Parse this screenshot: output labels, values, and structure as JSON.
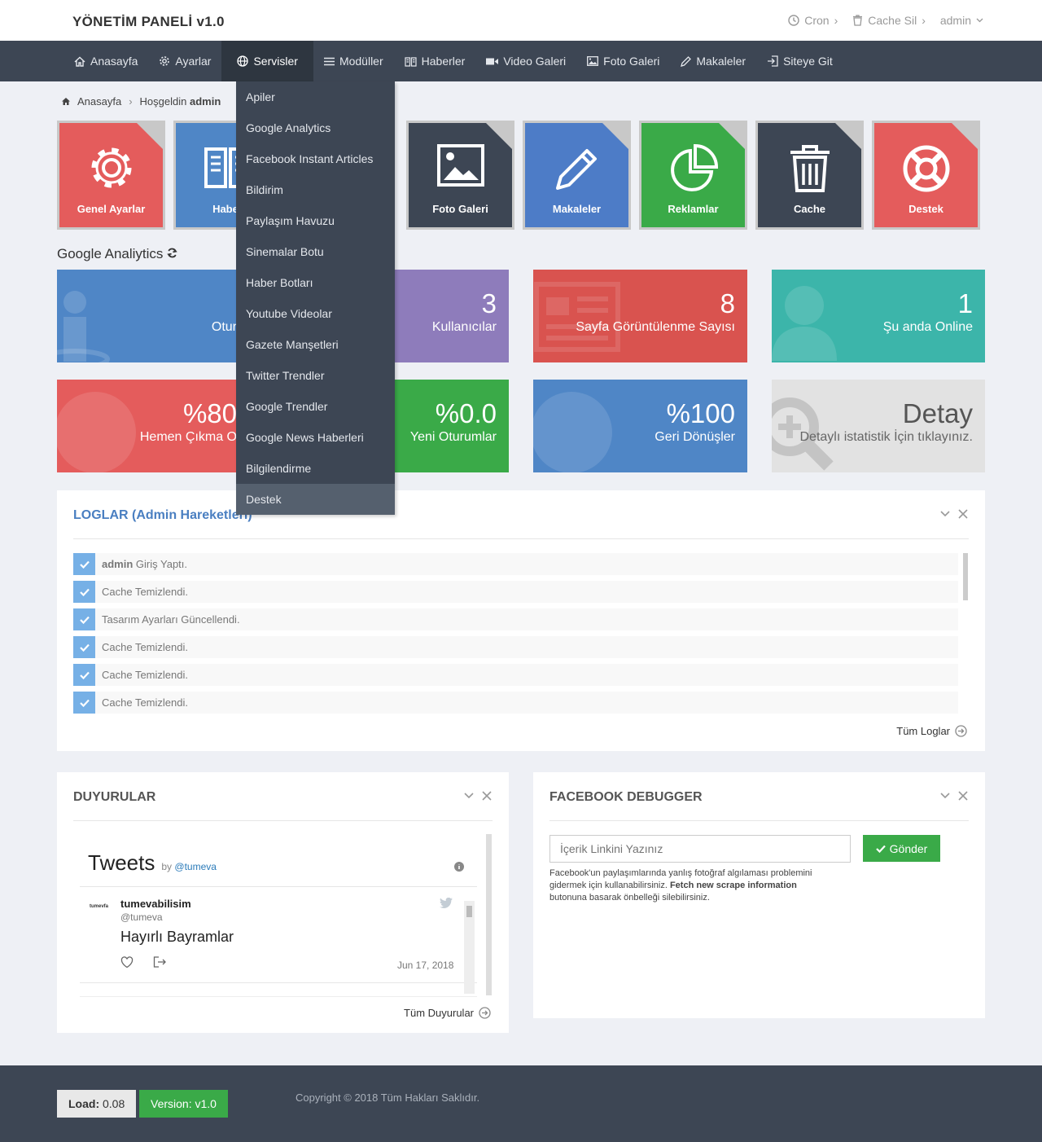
{
  "brand": {
    "name": "YÖNETİM PANELİ",
    "version": "v1.0"
  },
  "top": {
    "cron": "Cron",
    "cache": "Cache Sil",
    "user": "admin"
  },
  "nav": [
    "Anasayfa",
    "Ayarlar",
    "Servisler",
    "Modüller",
    "Haberler",
    "Video Galeri",
    "Foto Galeri",
    "Makaleler",
    "Siteye Git"
  ],
  "dropdown": [
    "Apiler",
    "Google Analytics",
    "Facebook Instant Articles",
    "Bildirim",
    "Paylaşım Havuzu",
    "Sinemalar Botu",
    "Haber Botları",
    "Youtube Videolar",
    "Gazete Manşetleri",
    "Twitter Trendler",
    "Google Trendler",
    "Google News Haberleri",
    "Bilgilendirme",
    "Destek"
  ],
  "breadcrumb": {
    "home": "Anasayfa",
    "welcome": "Hoşgeldin",
    "user": "admin"
  },
  "tiles": [
    {
      "label": "Genel Ayarlar",
      "color": "#e45c5c",
      "icon": "gear-icon"
    },
    {
      "label": "Haber",
      "color": "#4f86c6",
      "icon": "book-icon"
    },
    {
      "label": "Foto Galeri",
      "color": "#3d4654",
      "icon": "image-icon"
    },
    {
      "label": "Makaleler",
      "color": "#4d7cc7",
      "icon": "pencil-icon"
    },
    {
      "label": "Reklamlar",
      "color": "#3aaa48",
      "icon": "pie-chart-icon"
    },
    {
      "label": "Cache",
      "color": "#3d4654",
      "icon": "trash-icon"
    },
    {
      "label": "Destek",
      "color": "#e45c5c",
      "icon": "lifebuoy-icon"
    }
  ],
  "analytics": {
    "title": "Google Analiytics",
    "stats": [
      {
        "num": "",
        "label": "Otur",
        "color": "#4f86c6"
      },
      {
        "num": "3",
        "label": "Kullanıcılar",
        "color": "#8e7cbb"
      },
      {
        "num": "8",
        "label": "Sayfa Görüntülenme Sayısı",
        "color": "#d9534f"
      },
      {
        "num": "1",
        "label": "Şu anda Online",
        "color": "#3cb5aa"
      },
      {
        "num": "%80",
        "label": "Hemen Çıkma O",
        "color": "#e45c5c"
      },
      {
        "num": "%0.0",
        "label": "Yeni Oturumlar",
        "color": "#3aaa48"
      },
      {
        "num": "%100",
        "label": "Geri Dönüşler",
        "color": "#4f86c6"
      },
      {
        "num": "Detay",
        "label": "Detaylı istatistik İçin tıklayınız.",
        "color": "#e2e2e2"
      }
    ]
  },
  "logs": {
    "title": "LOGLAR (Admin Hareketleri)",
    "user": "admin",
    "first": "Giriş Yaptı.",
    "items": [
      "Cache Temizlendi.",
      "Tasarım Ayarları Güncellendi.",
      "Cache Temizlendi.",
      "Cache Temizlendi.",
      "Cache Temizlendi."
    ],
    "more": "Tüm Loglar"
  },
  "duyurular": {
    "title": "DUYURULAR",
    "tweets": "Tweets",
    "by": "by",
    "handle": "@tumeva",
    "name": "tumevabilisim",
    "at": "@tumeva",
    "text": "Hayırlı Bayramlar",
    "date": "Jun 17, 2018",
    "logo": "tumevfa",
    "more": "Tüm Duyurular"
  },
  "facebook": {
    "title": "FACEBOOK DEBUGGER",
    "placeholder": "İçerik Linkini Yazınız",
    "button": "Gönder",
    "help1": "Facebook'un paylaşımlarında yanlış fotoğraf algılaması problemini gidermek için kullanabilirsiniz.",
    "help_bold": "Fetch new scrape information",
    "help2": "butonuna basarak önbelleği silebilirsiniz."
  },
  "footer": {
    "load_label": "Load:",
    "load": "0.08",
    "version": "Version: v1.0",
    "copyright": "Copyright © 2018 Tüm Hakları Saklıdır."
  }
}
